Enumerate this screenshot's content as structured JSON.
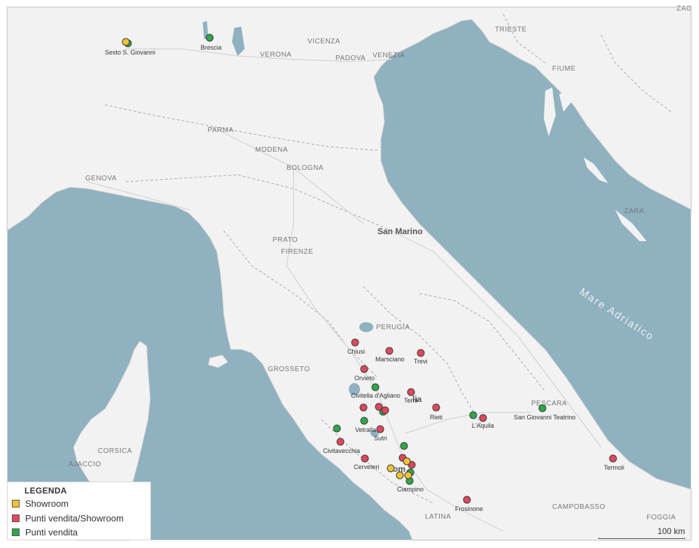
{
  "colors": {
    "sea": "#8fb1c0",
    "land": "#f2f2f2",
    "border": "#b8b8b8",
    "showroom": "#f1c232",
    "punti_showroom": "#e0475b",
    "punti_vendita": "#2ea84a",
    "marker_stroke": "#3a3a3a"
  },
  "map_labels": {
    "trieste": "TRIESTE",
    "vicenza": "VICENZA",
    "verona": "VERONA",
    "padova": "PADOVA",
    "venezia": "VENEZIA",
    "fiume": "FIUME",
    "zag": "ZAG",
    "parma": "PARMA",
    "modena": "MODENA",
    "bologna": "BOLOGNA",
    "genova": "GENOVA",
    "zara": "ZARA",
    "san_marino": "San Marino",
    "prato": "PRATO",
    "firenze": "FIRENZE",
    "mare_adriatico": "Mare Adriatico",
    "perugia": "PERUGIA",
    "grosseto": "GROSSETO",
    "pescara": "PESCARA",
    "corsica": "CORSICA",
    "ajaccio": "AJACCIO",
    "campobasso": "CAMPOBASSO",
    "latina": "LATINA",
    "foggia": "FOGGIA",
    "lia": "lia",
    "roma_fragment": "om"
  },
  "locations": {
    "sesto": "Sesto S. Giovanni",
    "brescia": "Brescia",
    "chiusi": "Chiusi",
    "marsciano": "Marsciano",
    "trevi": "Trevi",
    "orvieto": "Orvieto",
    "civitella": "Civitella d'Agliano",
    "terni": "Terni",
    "rieti": "Rieti",
    "laquila": "L'Aquila",
    "sangiovanni": "San Giovanni Teatrino",
    "vetralla": "Vetralla",
    "sutri": "Sutri",
    "civitavecchia": "Civitavecchia",
    "cerveteri": "Cerveteri",
    "ciampino": "Ciampino",
    "frosinone": "Frosinone",
    "termoli": "Termoli"
  },
  "legend": {
    "title": "LEGENDA",
    "items": [
      {
        "label": "Showroom",
        "color": "#f1c232"
      },
      {
        "label": "Punti vendita/Showroom",
        "color": "#e0475b"
      },
      {
        "label": "Punti vendita",
        "color": "#2ea84a"
      }
    ]
  },
  "scale": {
    "label": "100 km"
  }
}
